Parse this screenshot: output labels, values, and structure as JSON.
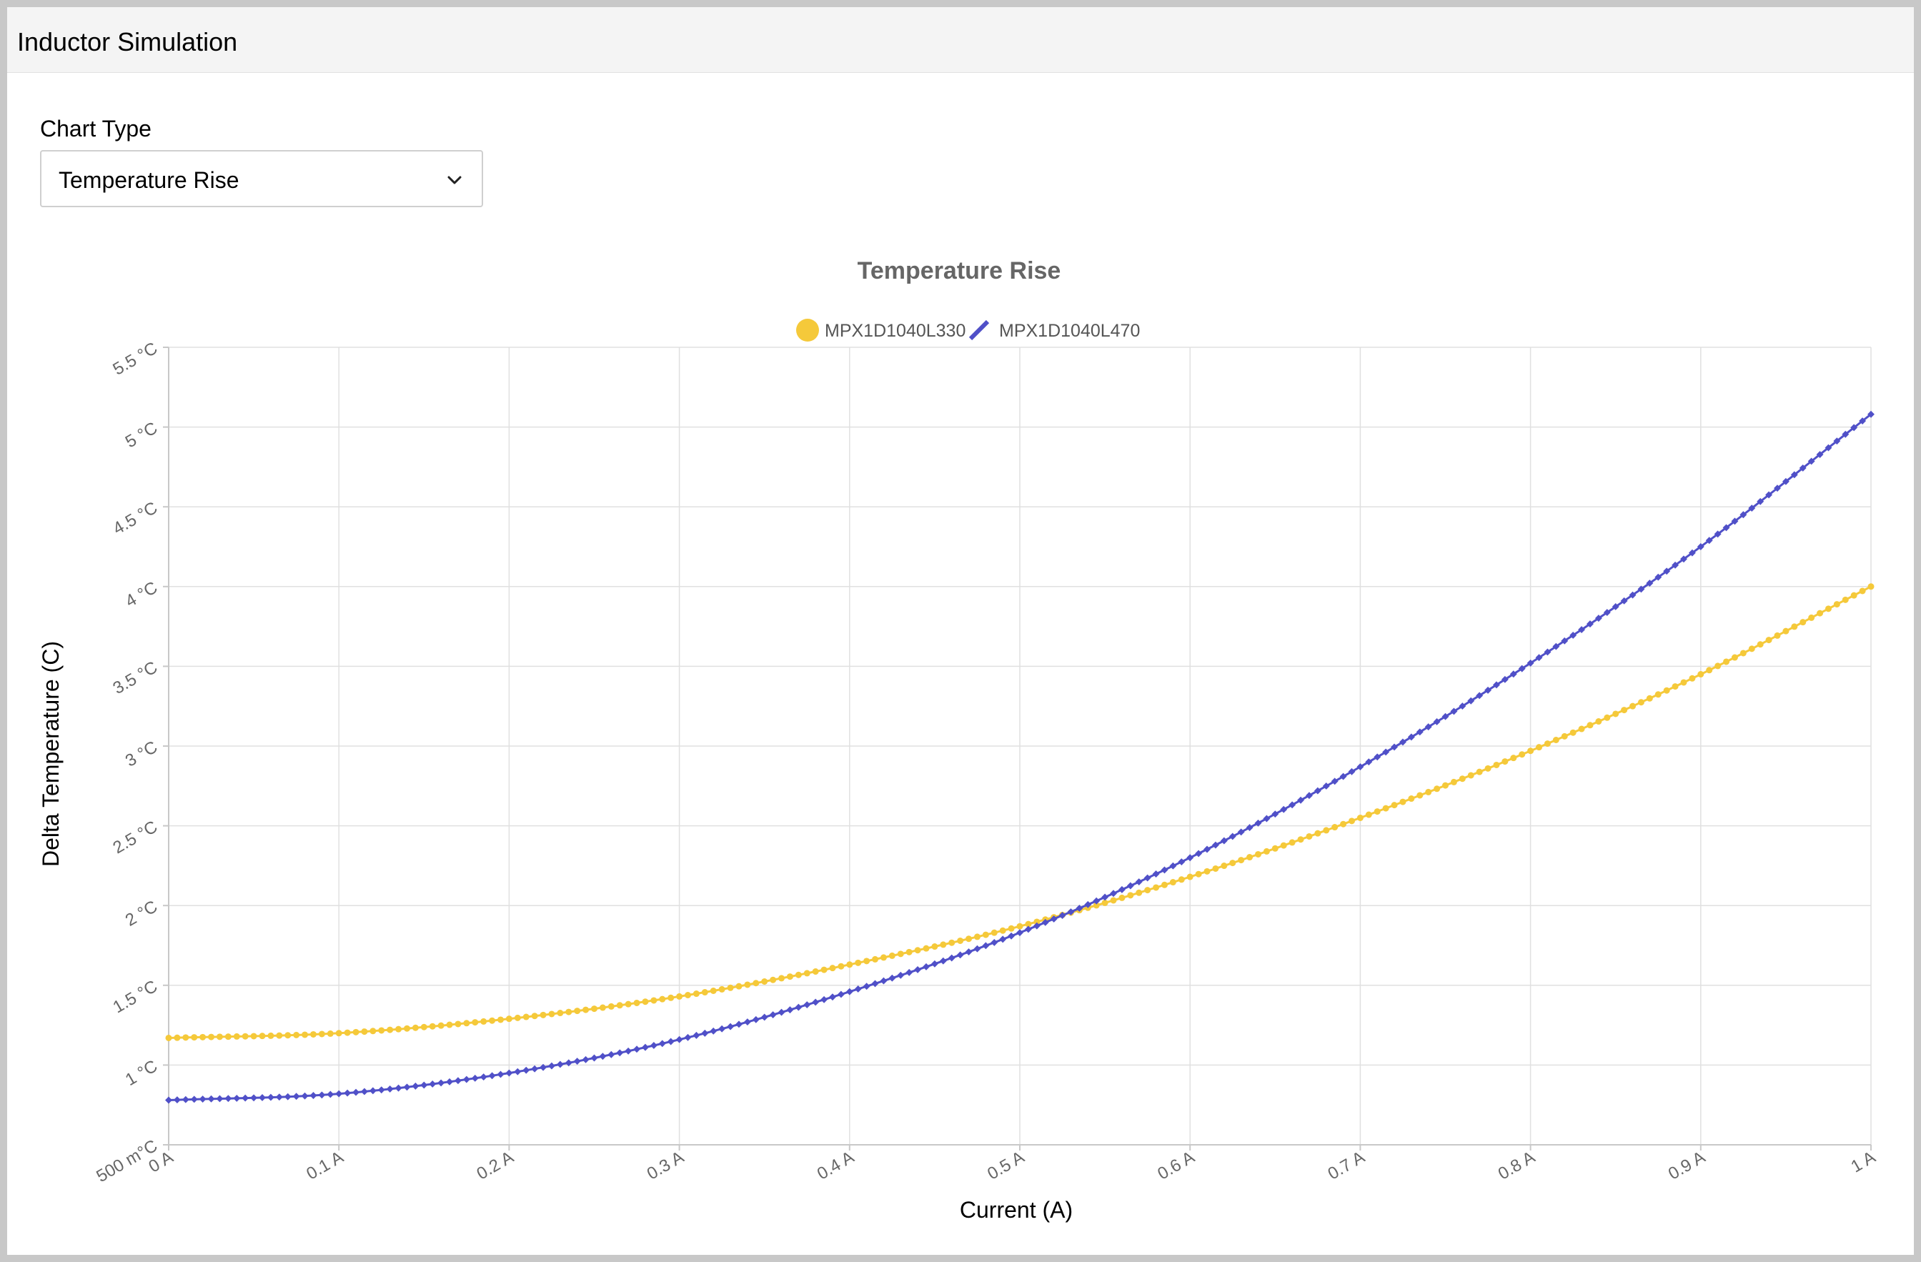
{
  "app": {
    "title": "Inductor Simulation"
  },
  "controls": {
    "chart_type_label": "Chart Type",
    "chart_type_selected": "Temperature Rise"
  },
  "chart_data": {
    "type": "line",
    "title": "Temperature Rise",
    "xlabel": "Current (A)",
    "ylabel": "Delta Temperature (C)",
    "xlim": [
      0,
      1
    ],
    "ylim": [
      0.5,
      5.5
    ],
    "grid": true,
    "legend_position": "top-center",
    "x_ticks": [
      0,
      0.1,
      0.2,
      0.3,
      0.4,
      0.5,
      0.6,
      0.7,
      0.8,
      0.9,
      1
    ],
    "x_tick_labels": [
      "0 A",
      "0.1 A",
      "0.2 A",
      "0.3 A",
      "0.4 A",
      "0.5 A",
      "0.6 A",
      "0.7 A",
      "0.8 A",
      "0.9 A",
      "1 A"
    ],
    "y_ticks": [
      0.5,
      1,
      1.5,
      2,
      2.5,
      3,
      3.5,
      4,
      4.5,
      5,
      5.5
    ],
    "y_tick_labels": [
      "500 m°C",
      "1 °C",
      "1.5 °C",
      "2 °C",
      "2.5 °C",
      "3 °C",
      "3.5 °C",
      "4 °C",
      "4.5 °C",
      "5 °C",
      "5.5 °C"
    ],
    "series": [
      {
        "name": "MPX1D1040L330",
        "color": "#f5c93a",
        "marker": "circle",
        "x": [
          0,
          0.1,
          0.2,
          0.3,
          0.4,
          0.5,
          0.6,
          0.7,
          0.8,
          0.9,
          1.0
        ],
        "y": [
          1.17,
          1.2,
          1.29,
          1.43,
          1.63,
          1.87,
          2.18,
          2.55,
          2.97,
          3.45,
          4.0
        ]
      },
      {
        "name": "MPX1D1040L470",
        "color": "#5050c8",
        "marker": "diamond",
        "x": [
          0,
          0.1,
          0.2,
          0.3,
          0.4,
          0.5,
          0.6,
          0.7,
          0.8,
          0.9,
          1.0
        ],
        "y": [
          0.78,
          0.82,
          0.95,
          1.16,
          1.46,
          1.83,
          2.3,
          2.87,
          3.52,
          4.25,
          5.08
        ]
      }
    ]
  }
}
